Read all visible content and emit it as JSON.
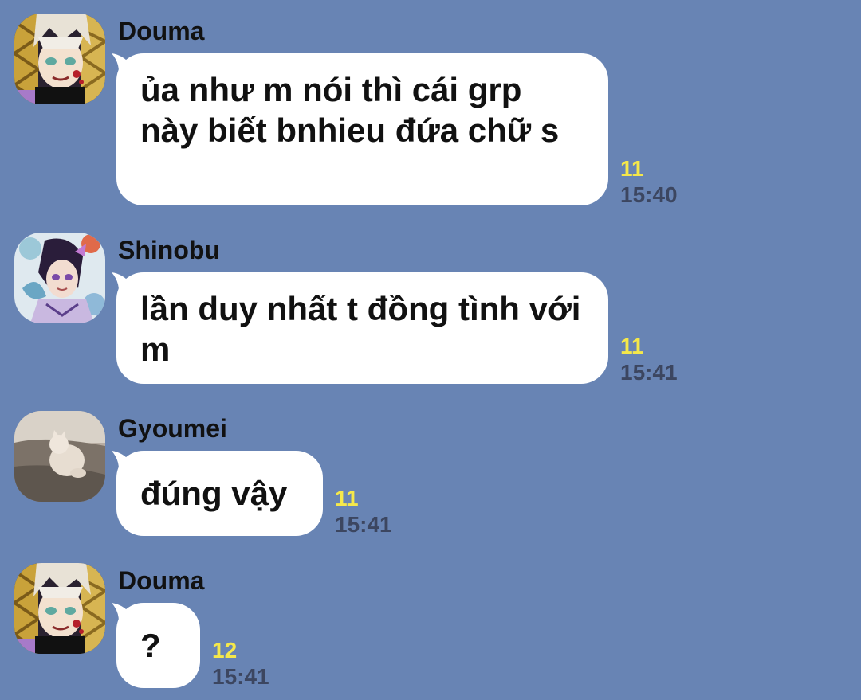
{
  "background_color": "#6884b4",
  "colors": {
    "read_count": "#f5e84a",
    "timestamp": "#3c4660",
    "bubble": "#ffffff"
  },
  "messages": [
    {
      "sender": "Douma",
      "avatar": "douma-avatar",
      "text": "ủa như m nói thì cái grp này biết bnhieu đứa chữ s",
      "read_count": "11",
      "time": "15:40"
    },
    {
      "sender": "Shinobu",
      "avatar": "shinobu-avatar",
      "text": "lần duy nhất t đồng tình với m",
      "read_count": "11",
      "time": "15:41"
    },
    {
      "sender": "Gyoumei",
      "avatar": "gyoumei-cat-avatar",
      "text": "đúng vậy",
      "read_count": "11",
      "time": "15:41"
    },
    {
      "sender": "Douma",
      "avatar": "douma-avatar",
      "text": "?",
      "read_count": "12",
      "time": "15:41"
    }
  ]
}
